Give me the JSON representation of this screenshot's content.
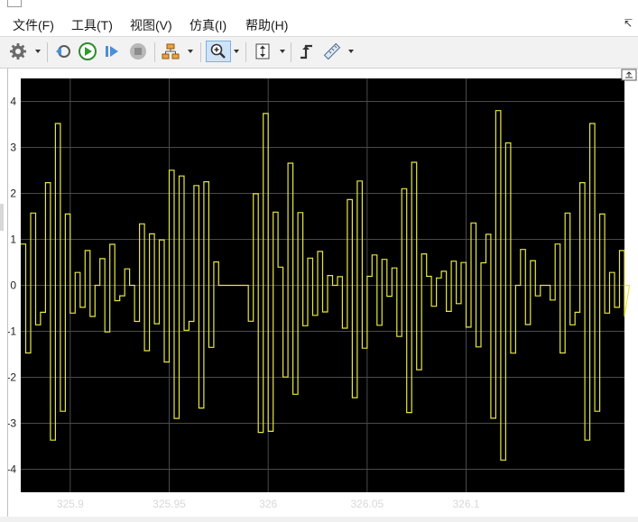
{
  "menu": {
    "items": [
      {
        "label": "文件(F)"
      },
      {
        "label": "工具(T)"
      },
      {
        "label": "视图(V)"
      },
      {
        "label": "仿真(I)"
      },
      {
        "label": "帮助(H)"
      }
    ],
    "expand_icon": "pin-arrow-icon"
  },
  "toolbar": {
    "buttons": [
      {
        "name": "settings-button",
        "icon": "gear-icon"
      },
      {
        "name": "step-back-button",
        "icon": "step-back-icon"
      },
      {
        "name": "run-button",
        "icon": "play-icon"
      },
      {
        "name": "step-forward-button",
        "icon": "step-forward-icon"
      },
      {
        "name": "stop-button",
        "icon": "stop-icon"
      },
      {
        "name": "highlight-block-button",
        "icon": "signal-tree-icon"
      },
      {
        "name": "zoom-button",
        "icon": "zoom-in-icon",
        "active": true
      },
      {
        "name": "scale-axes-button",
        "icon": "fit-to-view-icon"
      },
      {
        "name": "triggers-button",
        "icon": "trigger-icon"
      },
      {
        "name": "measurements-button",
        "icon": "ruler-icon"
      }
    ]
  },
  "colors": {
    "plot_background": "#000000",
    "grid": "#4a4a4a",
    "signal": "#e6e642",
    "tick_label": "#d8d8d8"
  },
  "chart_data": {
    "type": "line",
    "style": "step",
    "title": "",
    "xlabel": "",
    "ylabel": "",
    "xlim": [
      325.875,
      326.18
    ],
    "ylim": [
      -4.5,
      4.5
    ],
    "yticks": [
      4,
      3,
      2,
      1,
      0,
      -1,
      -2,
      -3,
      -4
    ],
    "xticks": [
      325.9,
      325.95,
      326,
      326.05,
      326.1
    ],
    "xtick_labels": [
      "325.9",
      "325.95",
      "326",
      "326.05",
      "326.1"
    ],
    "grid": true,
    "legend": "none",
    "series": [
      {
        "color": "#e6e642",
        "sample_time": 0.0025,
        "period": 0.054,
        "approx_amplitude": 3.8
      }
    ]
  }
}
